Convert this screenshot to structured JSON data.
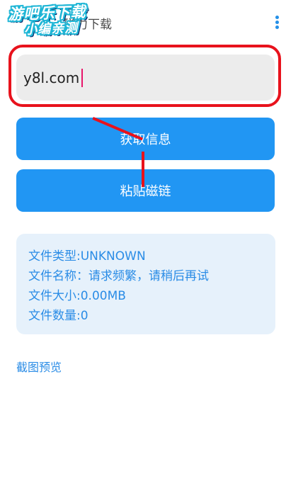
{
  "header": {
    "title": "磁力下载",
    "watermark_line1": "游吧乐下载",
    "watermark_line2": "小编亲测"
  },
  "input": {
    "value": "y8l.com"
  },
  "buttons": {
    "get_info": "获取信息",
    "paste_magnet": "粘贴磁链"
  },
  "info": {
    "file_type": "文件类型:UNKNOWN",
    "file_name": "文件名称：请求频繁，请稍后再试",
    "file_size": "文件大小:0.00MB",
    "file_count": "文件数量:0"
  },
  "preview_link": "截图预览",
  "colors": {
    "accent": "#2196f3",
    "highlight_red": "#e8121c",
    "info_bg": "#e6f1fb",
    "info_text": "#2a8ce6"
  }
}
